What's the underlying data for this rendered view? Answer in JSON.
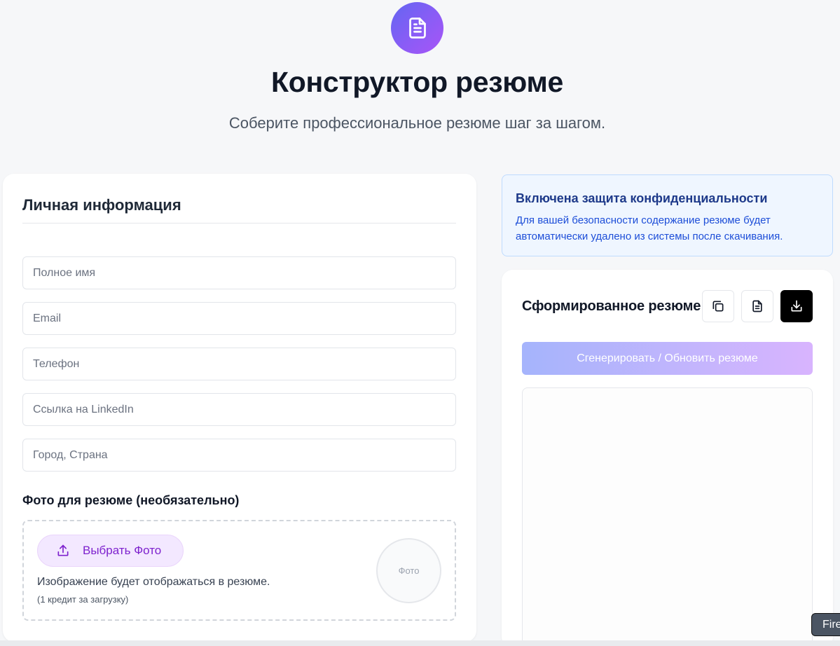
{
  "header": {
    "icon": "document-icon",
    "title": "Конструктор резюме",
    "subtitle": "Соберите профессиональное резюме шаг за шагом."
  },
  "personal": {
    "title": "Личная информация",
    "fields": {
      "full_name": "Полное имя",
      "email": "Email",
      "phone": "Телефон",
      "linkedin": "Ссылка на LinkedIn",
      "city": "Город, Страна"
    }
  },
  "photo": {
    "heading": "Фото для резюме (необязательно)",
    "choose_label": "Выбрать Фото",
    "note": "Изображение будет отображаться в резюме.",
    "credit": "(1 кредит за загрузку)",
    "placeholder": "Фото"
  },
  "privacy": {
    "title": "Включена защита конфиденциальности",
    "text": "Для вашей безопасности содержание резюме будет автоматически удалено из системы после скачивания."
  },
  "result": {
    "title": "Сформированное резюме",
    "icons": [
      "copy-icon",
      "document-icon",
      "download-icon"
    ],
    "generate_label": "Сгенерировать / Обновить резюме"
  },
  "badge": {
    "label": "Fire"
  },
  "colors": {
    "accent_gradient_start": "#6366f1",
    "accent_gradient_end": "#a855f7",
    "privacy_title": "#1e3a8a",
    "privacy_text": "#1d4ed8",
    "choose_button_text": "#7e22ce"
  }
}
